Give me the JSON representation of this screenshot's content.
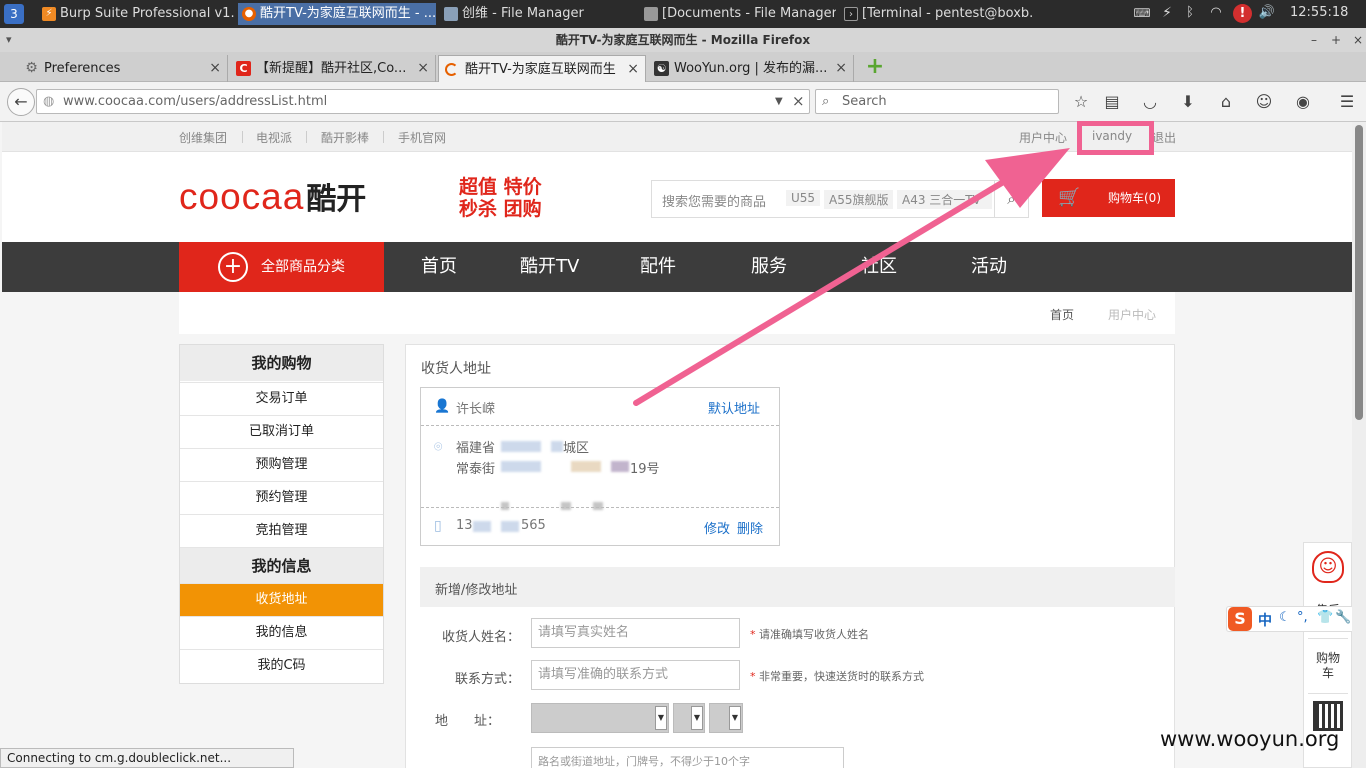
{
  "taskbar": {
    "items": [
      {
        "label": "Burp Suite Professional v1..."
      },
      {
        "label": "酷开TV-为家庭互联网而生 - ..."
      },
      {
        "label": "创维 - File Manager"
      },
      {
        "label": "[Documents - File Manager]"
      },
      {
        "label": "[Terminal - pentest@boxb..."
      }
    ],
    "clock": "12:55:18"
  },
  "window": {
    "title": "酷开TV-为家庭互联网而生 - Mozilla Firefox"
  },
  "tabs": [
    {
      "label": "Preferences"
    },
    {
      "label": "【新提醒】酷开社区,Co..."
    },
    {
      "label": "酷开TV-为家庭互联网而生"
    },
    {
      "label": "WooYun.org | 发布的漏..."
    }
  ],
  "navbar": {
    "url": "www.coocaa.com/users/addressList.html",
    "search_placeholder": "Search"
  },
  "site": {
    "topbar": {
      "left_links": [
        "创维集团",
        "电视派",
        "酷开影棒",
        "手机官网"
      ],
      "user_center": "用户中心",
      "username": "ivandy",
      "logout": "退出"
    },
    "logo": {
      "latin": "COOCAA",
      "cn": "酷开"
    },
    "slogan": {
      "line1": "超值 特价",
      "line2": "秒杀 团购"
    },
    "search": {
      "placeholder": "搜索您需要的商品",
      "tags": [
        "U55",
        "A55旗舰版",
        "A43 三合一TV"
      ]
    },
    "cart": "购物车(0)",
    "nav": {
      "all_categories": "全部商品分类",
      "items": [
        "首页",
        "酷开TV",
        "配件",
        "服务",
        "社区",
        "活动"
      ]
    },
    "breadcrumb": [
      "首页",
      "用户中心"
    ],
    "sidebar": {
      "shopping_head": "我的购物",
      "shopping_items": [
        "交易订单",
        "已取消订单",
        "预购管理",
        "预约管理",
        "竞拍管理"
      ],
      "info_head": "我的信息",
      "info_items": [
        "收货地址",
        "我的信息",
        "我的C码"
      ]
    },
    "address_section": {
      "title": "收货人地址",
      "card": {
        "name": "许长嵘",
        "default": "默认地址",
        "addr1_a": "福建省",
        "addr1_b": "城区",
        "addr2_a": "常泰街",
        "addr2_b": "19号",
        "phone_a": "13",
        "phone_b": "565",
        "edit": "修改",
        "delete": "删除"
      }
    },
    "form": {
      "title": "新增/修改地址",
      "name_label": "收货人姓名：",
      "name_placeholder": "请填写真实姓名",
      "name_hint": "请准确填写收货人姓名",
      "phone_label": "联系方式：",
      "phone_placeholder": "请填写准确的联系方式",
      "phone_hint": "非常重要，快速送货时的联系方式",
      "addr_label": "地　　址：",
      "street_placeholder": "路名或街道地址，门牌号，不得少于10个字"
    },
    "side_float": {
      "service": "售后",
      "cart_line1": "购物",
      "cart_line2": "车"
    },
    "ime": {
      "chars": "中"
    },
    "watermark": "www.wooyun.org"
  },
  "status": "Connecting to cm.g.doubleclick.net...",
  "colors": {
    "brand_red": "#e0261b",
    "accent_orange": "#f29305",
    "annotation_pink": "#f06292",
    "nav_dark": "#3c3c3c"
  }
}
